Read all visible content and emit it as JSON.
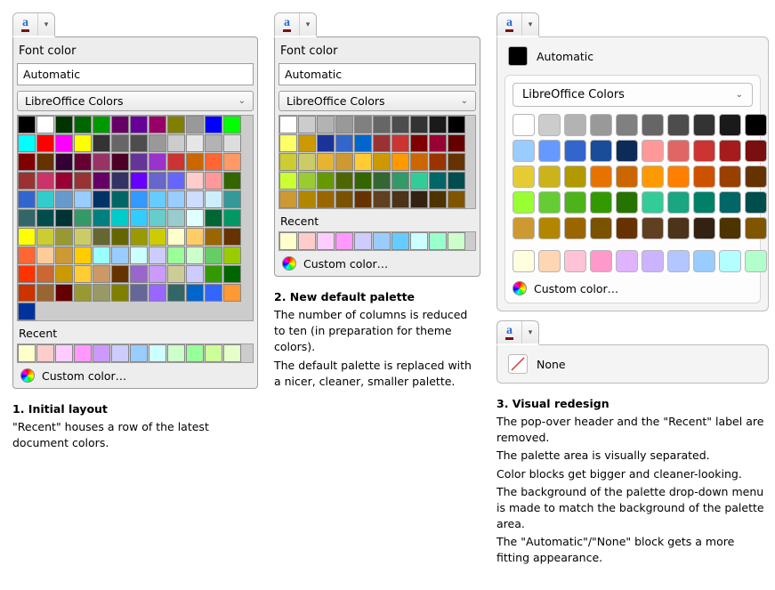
{
  "icon": {
    "letter": "a"
  },
  "labels": {
    "fontColor": "Font color",
    "automatic": "Automatic",
    "none": "None",
    "paletteName": "LibreOffice Colors",
    "recent": "Recent",
    "customColor": "Custom color…"
  },
  "recentColors": [
    "#ffffcc",
    "#ffcccc",
    "#ffccff",
    "#ff99ff",
    "#cc99ff",
    "#ccccff",
    "#99ccff",
    "#ccffff",
    "#ccffcc",
    "#99ff99",
    "#ccff99",
    "#e5ffcc"
  ],
  "recentColors10": [
    "#ffffcc",
    "#ffcccc",
    "#ffccff",
    "#ff99ff",
    "#ccccff",
    "#99ccff",
    "#66ccff",
    "#ccffff",
    "#99ffcc",
    "#ccffcc"
  ],
  "palette12": [
    [
      "#000000",
      "#ffffff",
      "#003300",
      "#006600",
      "#009900",
      "#660066",
      "#660099",
      "#990066",
      "#808000",
      "#999999",
      "#0000ff",
      "#00ff00"
    ],
    [
      "#00ffff",
      "#ff0000",
      "#ff00ff",
      "#ffff00",
      "#333333",
      "#666666",
      "#4d4d4d",
      "#999999",
      "#cccccc",
      "#e6e6e6",
      "#b3b3b3",
      "#dddddd"
    ],
    [
      "#800000",
      "#663300",
      "#330033",
      "#660033",
      "#993366",
      "#4d0026",
      "#663399",
      "#9933cc",
      "#cc3333",
      "#cc6600",
      "#ff6633",
      "#ff9966"
    ],
    [
      "#993333",
      "#cc3366",
      "#990033",
      "#993333",
      "#660066",
      "#333366",
      "#6600ff",
      "#6666cc",
      "#6666ff",
      "#ffcccc",
      "#ff9999",
      "#336600"
    ],
    [
      "#3366cc",
      "#33cccc",
      "#6699cc",
      "#99ccff",
      "#003366",
      "#006666",
      "#3399ff",
      "#66ccff",
      "#99ccff",
      "#ccddff",
      "#cceeff",
      "#339999"
    ],
    [
      "#336666",
      "#004d4d",
      "#003333",
      "#339966",
      "#008080",
      "#00cccc",
      "#33ccff",
      "#66cccc",
      "#99cccc",
      "#e0ffff",
      "#006633",
      "#009966"
    ],
    [
      "#ffff00",
      "#cccc33",
      "#999933",
      "#cccc66",
      "#666633",
      "#666600",
      "#999900",
      "#cccc00",
      "#ffffcc",
      "#ffcc66",
      "#996600",
      "#663300"
    ],
    [
      "#ff6633",
      "#ffcc99",
      "#cc9933",
      "#ffcc00",
      "#99ffff",
      "#99ccff",
      "#ccffff",
      "#ccccff",
      "#99ff99",
      "#ccffcc",
      "#66cc66",
      "#99cc00"
    ],
    [
      "#ff3300",
      "#cc6633",
      "#cc9900",
      "#ffcc33",
      "#cc9966",
      "#663300",
      "#9966cc",
      "#cc99ff",
      "#cccc99",
      "#ccccff",
      "#339900",
      "#006600"
    ],
    [
      "#cc3300",
      "#996633",
      "#660000",
      "#999933",
      "#999966",
      "#808000",
      "#666699",
      "#9966ff",
      "#336666",
      "#0066cc",
      "#3366ff",
      "#ff9933"
    ],
    [
      "#003399"
    ]
  ],
  "palette10": [
    [
      "#ffffff",
      "#cccccc",
      "#b3b3b3",
      "#999999",
      "#808080",
      "#666666",
      "#4d4d4d",
      "#333333",
      "#1a1a1a",
      "#000000"
    ],
    [
      "#ffff66",
      "#cc9900",
      "#1a3399",
      "#3366cc",
      "#0066cc",
      "#993333",
      "#cc3333",
      "#800000",
      "#990033",
      "#660000"
    ],
    [
      "#cccc33",
      "#cccc66",
      "#e6b333",
      "#cc9933",
      "#ffcc33",
      "#cc9900",
      "#ff9900",
      "#cc6600",
      "#993300",
      "#663300"
    ],
    [
      "#ccff33",
      "#99cc33",
      "#669900",
      "#4d6600",
      "#336600",
      "#336633",
      "#339966",
      "#33cc99",
      "#006666",
      "#004d4d"
    ],
    [
      "#cc9933",
      "#b38600",
      "#996600",
      "#7a5200",
      "#663300",
      "#604020",
      "#4d3319",
      "#332211",
      "#4d3300",
      "#805500"
    ]
  ],
  "redesignPalette": [
    [
      "#ffffff",
      "#cccccc",
      "#b3b3b3",
      "#999999",
      "#808080",
      "#666666",
      "#4d4d4d",
      "#333333",
      "#1a1a1a",
      "#000000"
    ],
    [
      "#99ccff",
      "#6699ff",
      "#3366cc",
      "#1a4d99",
      "#0d2b57",
      "#ff9999",
      "#e06666",
      "#cc3333",
      "#a61c1c",
      "#7a0f0f"
    ],
    [
      "#e6cc33",
      "#ccb31a",
      "#b39900",
      "#e67300",
      "#cc6600",
      "#ff9900",
      "#ff7f00",
      "#cc5200",
      "#994000",
      "#663300"
    ],
    [
      "#99ff33",
      "#66cc33",
      "#4db31a",
      "#339900",
      "#267300",
      "#33cc99",
      "#1aa680",
      "#008066",
      "#006666",
      "#004d4d"
    ],
    [
      "#cc9933",
      "#b38600",
      "#996600",
      "#7a5200",
      "#663300",
      "#604020",
      "#4d3319",
      "#332211",
      "#4d3300",
      "#805500"
    ]
  ],
  "redesignRecent": [
    "#ffffe0",
    "#ffd6b3",
    "#ffc2d6",
    "#ff99cc",
    "#e0b3ff",
    "#ccb3ff",
    "#b3c6ff",
    "#99ccff",
    "#b3ffff",
    "#b3ffcc"
  ],
  "captions": {
    "c1": {
      "title": "1. Initial layout",
      "body": [
        "\"Recent\" houses a row of the latest document colors."
      ]
    },
    "c2": {
      "title": "2. New default palette",
      "body": [
        "The number of columns is reduced to ten (in preparation for theme colors).",
        "The default palette is replaced with a nicer, cleaner, smaller palette."
      ]
    },
    "c3": {
      "title": "3. Visual redesign",
      "body": [
        "The pop-over header and the \"Recent\" label are removed.",
        "The palette area is visually separated.",
        "Color blocks get bigger and cleaner-looking.",
        "The background of the palette drop-down menu is made to match the background of the palette area.",
        "The \"Automatic\"/\"None\" block gets a more fitting appearance."
      ]
    }
  }
}
